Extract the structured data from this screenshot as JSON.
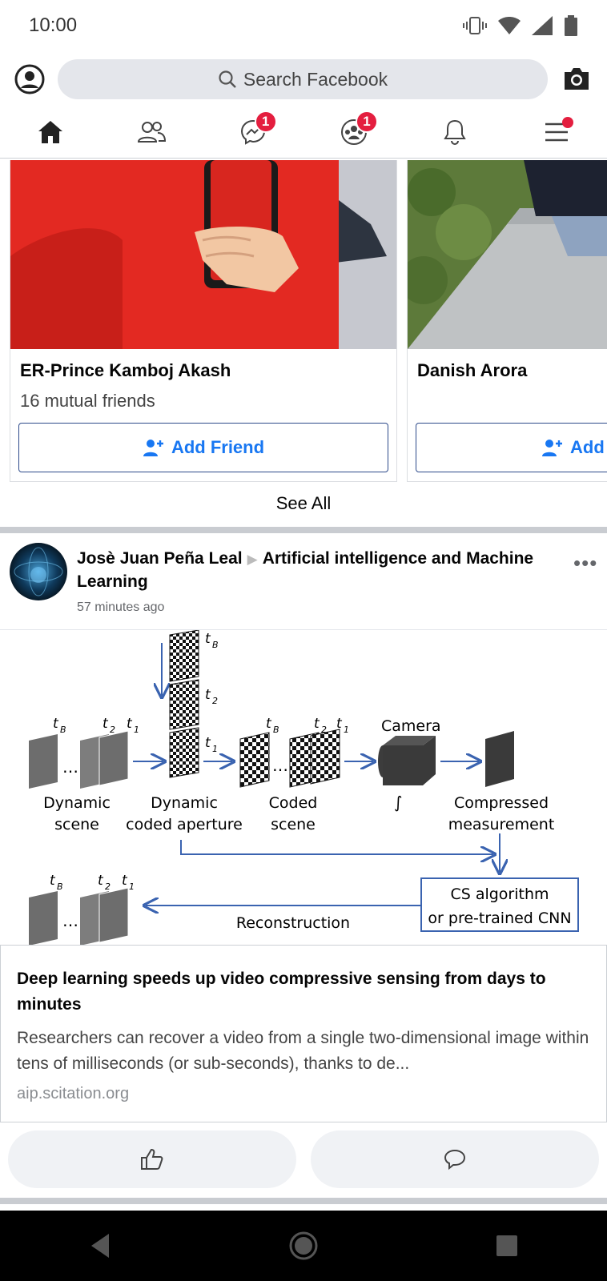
{
  "status_bar": {
    "time": "10:00"
  },
  "top_bar": {
    "search_placeholder": "Search Facebook"
  },
  "nav_tabs": [
    {
      "name": "home",
      "badge": ""
    },
    {
      "name": "friends",
      "badge": ""
    },
    {
      "name": "messenger",
      "badge": "1"
    },
    {
      "name": "groups",
      "badge": "1"
    },
    {
      "name": "notifications",
      "badge": ""
    },
    {
      "name": "menu",
      "badge": ""
    }
  ],
  "suggestions": {
    "cards": [
      {
        "name": "ER-Prince Kamboj Akash",
        "mutual": "16 mutual friends",
        "button": "Add Friend"
      },
      {
        "name": "Danish Arora",
        "mutual": "",
        "button": "Add"
      }
    ],
    "see_all": "See All"
  },
  "post": {
    "author": "Josè Juan Peña Leal",
    "group": "Artificial intelligence and Machine Learning",
    "time": "57 minutes ago",
    "figure": {
      "t_b": "t",
      "t_b_sub": "B",
      "t_2": "t",
      "t_2_sub": "2",
      "t_1": "t",
      "t_1_sub": "1",
      "label_dynamic_scene_1": "Dynamic",
      "label_dynamic_scene_2": "scene",
      "label_aperture_1": "Dynamic",
      "label_aperture_2": "coded aperture",
      "label_coded_1": "Coded",
      "label_coded_2": "scene",
      "label_camera": "Camera",
      "label_compressed_1": "Compressed",
      "label_compressed_2": "measurement",
      "label_cs_1": "CS algorithm",
      "label_cs_2": "or pre-trained CNN",
      "label_reconstruction": "Reconstruction"
    },
    "link": {
      "title": "Deep learning speeds up video compressive sensing from days to minutes",
      "description": "Researchers can recover a video from a single two-dimensional image within tens of milliseconds (or sub-seconds), thanks to de...",
      "domain": "aip.scitation.org"
    }
  }
}
